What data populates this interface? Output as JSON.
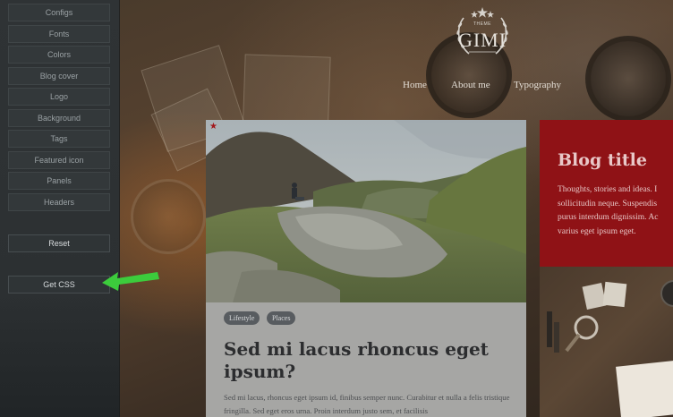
{
  "sidebar": {
    "items": [
      {
        "label": "Configs"
      },
      {
        "label": "Fonts"
      },
      {
        "label": "Colors"
      },
      {
        "label": "Blog cover"
      },
      {
        "label": "Logo"
      },
      {
        "label": "Background"
      },
      {
        "label": "Tags"
      },
      {
        "label": "Featured icon"
      },
      {
        "label": "Panels"
      },
      {
        "label": "Headers"
      }
    ],
    "reset_label": "Reset",
    "get_css_label": "Get CSS"
  },
  "header": {
    "logo_small": "THEME",
    "logo_text": "GIMI",
    "nav": [
      {
        "label": "Home"
      },
      {
        "label": "About me"
      },
      {
        "label": "Typography"
      }
    ]
  },
  "post": {
    "tags": [
      "Lifestyle",
      "Places"
    ],
    "title": "Sed mi lacus rhoncus eget ipsum?",
    "excerpt": "Sed mi lacus, rhoncus eget ipsum id, finibus semper nunc. Curabitur et nulla a felis tristique fringilla. Sed eget eros urna. Proin interdum justo sem, et facilisis"
  },
  "blog_widget": {
    "title": "Blog title",
    "lines": [
      "Thoughts, stories and ideas. I",
      "sollicitudin neque. Suspendis",
      "purus interdum dignissim. Ac",
      "varius eget ipsum eget."
    ]
  },
  "colors": {
    "sidebar_bg": "#2f3335",
    "accent_red": "#8f1216",
    "annotation_arrow": "#3ccc3c",
    "card_bg": "#a6a6a4"
  },
  "icons": {
    "featured": "star-icon",
    "annotation": "green-arrow-icon"
  }
}
